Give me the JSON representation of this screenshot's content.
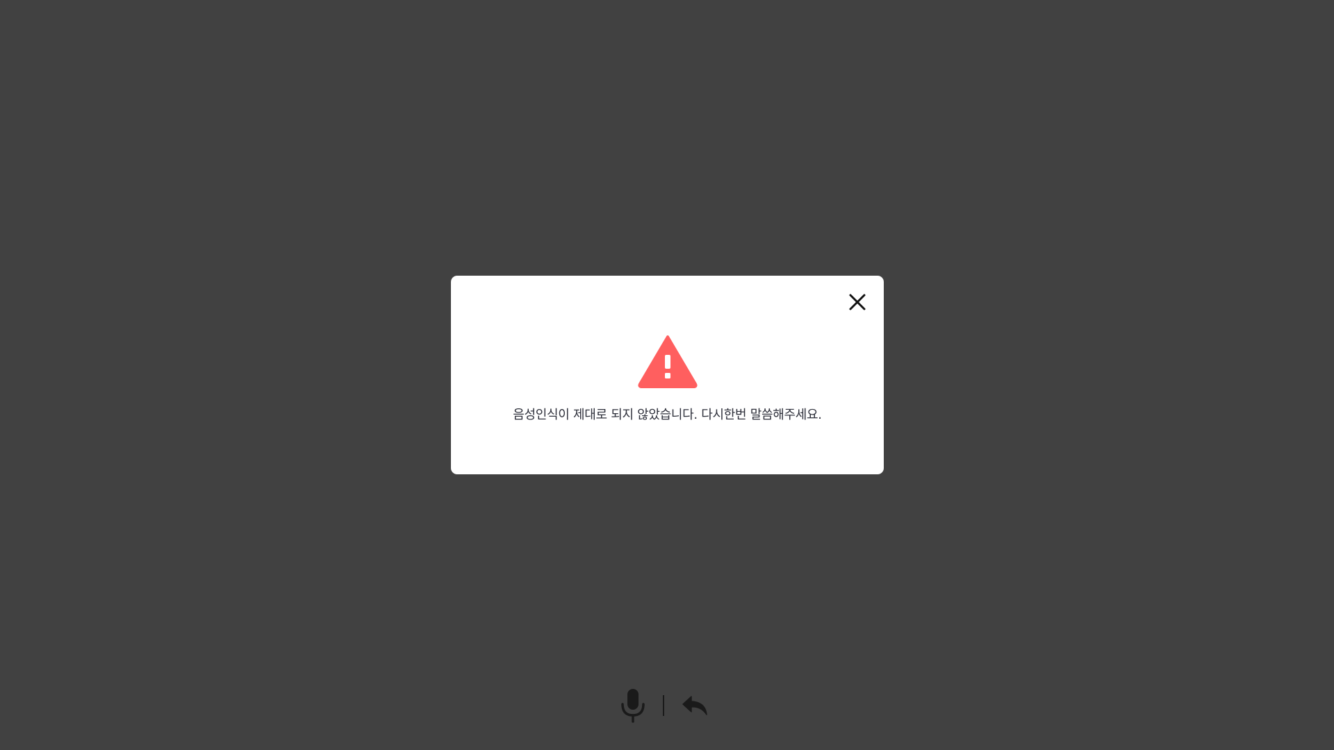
{
  "dialog": {
    "message": "음성인식이 제대로 되지 않았습니다. 다시한번 말씀해주세요.",
    "icon": "warning-icon",
    "close_icon": "close-icon"
  },
  "toolbar": {
    "mic_icon": "microphone-icon",
    "back_icon": "reply-back-icon"
  },
  "colors": {
    "backdrop": "#414141",
    "dialog_bg": "#ffffff",
    "warning": "#ff5f5f",
    "text": "#2d2f3a",
    "icon": "#1a1a1a"
  }
}
